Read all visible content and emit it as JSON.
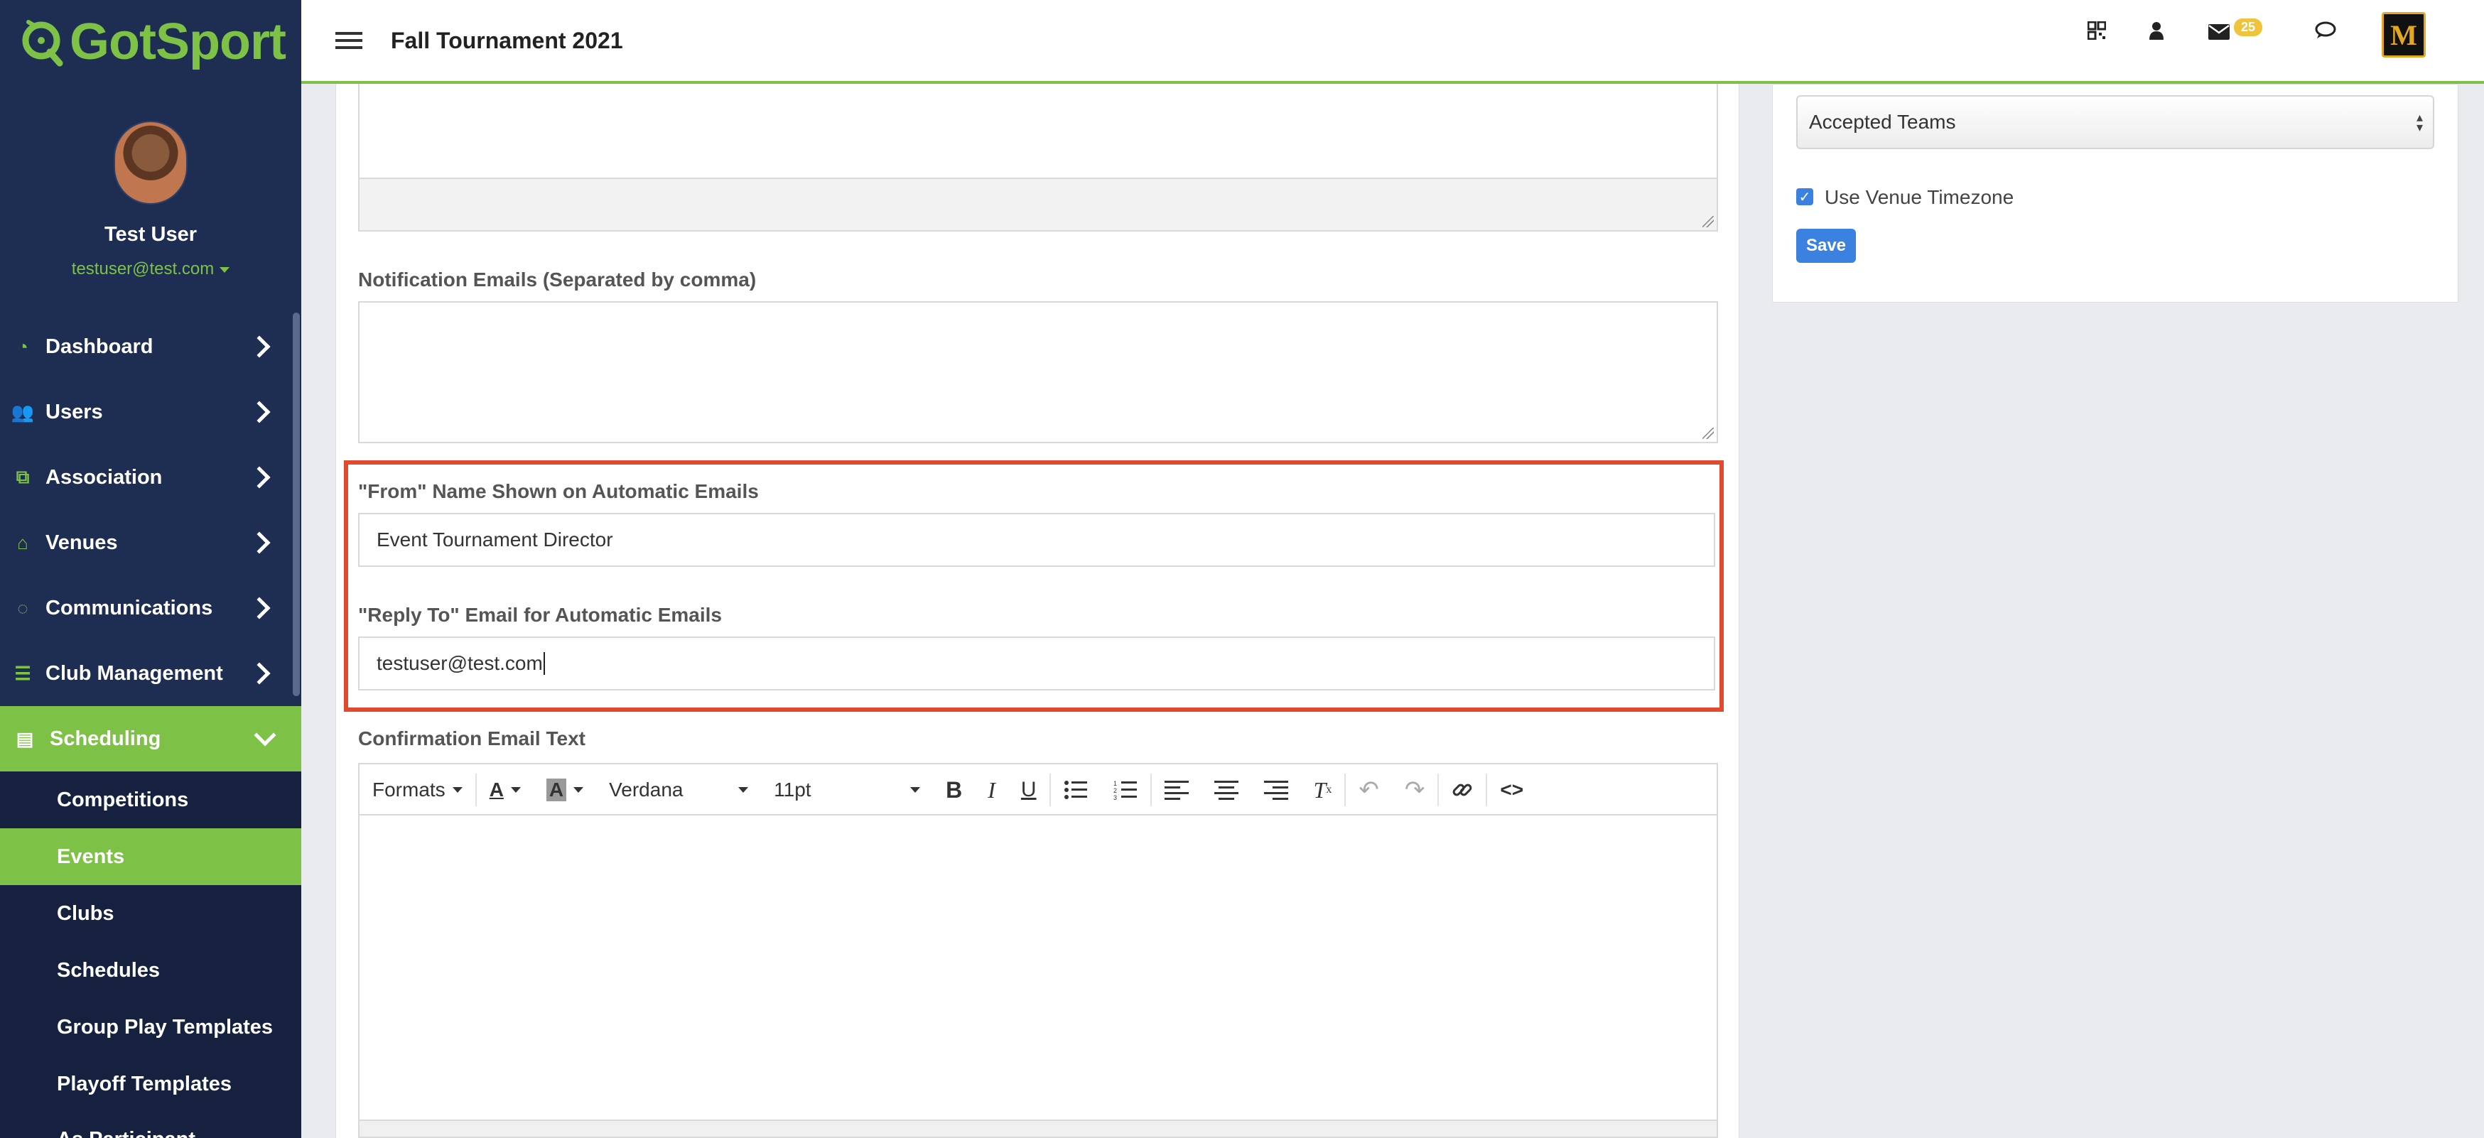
{
  "app": {
    "brand": "GotSport",
    "page_title": "Fall Tournament 2021"
  },
  "user": {
    "name": "Test User",
    "email": "testuser@test.com"
  },
  "nav": {
    "items": [
      {
        "label": "Dashboard",
        "icon": "dashboard-icon"
      },
      {
        "label": "Users",
        "icon": "users-icon"
      },
      {
        "label": "Association",
        "icon": "sitemap-icon"
      },
      {
        "label": "Venues",
        "icon": "home-icon"
      },
      {
        "label": "Communications",
        "icon": "chat-icon"
      },
      {
        "label": "Club Management",
        "icon": "list-icon"
      },
      {
        "label": "Scheduling",
        "icon": "calendar-icon",
        "active": true
      }
    ],
    "sub_items": [
      {
        "label": "Competitions"
      },
      {
        "label": "Events",
        "active": true
      },
      {
        "label": "Clubs"
      },
      {
        "label": "Schedules"
      },
      {
        "label": "Group Play Templates"
      },
      {
        "label": "Playoff Templates"
      },
      {
        "label": "As Participant"
      }
    ]
  },
  "topbar": {
    "badge_count": "25",
    "icons": [
      "qr-code-icon",
      "user-icon",
      "envelope-icon",
      "chat-bubbles-icon"
    ]
  },
  "form": {
    "notification_label": "Notification Emails (Separated by comma)",
    "from_label": "\"From\" Name Shown on Automatic Emails",
    "from_value": "Event Tournament Director",
    "reply_label": "\"Reply To\" Email for Automatic Emails",
    "reply_value": "testuser@test.com",
    "confirmation_label": "Confirmation Email Text"
  },
  "editor": {
    "formats": "Formats",
    "font": "Verdana",
    "size": "11pt"
  },
  "side": {
    "select_value": "Accepted Teams",
    "checkbox_label": "Use Venue Timezone",
    "checkbox_checked": true,
    "save_label": "Save"
  },
  "colors": {
    "brand_green": "#7dc246",
    "sidebar": "#1e2d52",
    "highlight": "#e04a2f",
    "primary": "#3b82e0"
  }
}
